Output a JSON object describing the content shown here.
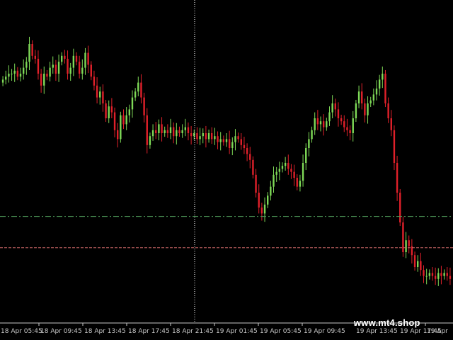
{
  "watermark": "www.mt4.shop",
  "chart_data": {
    "type": "candlestick",
    "up_color": "#7ed957",
    "down_color": "#e0202a",
    "background": "#000000",
    "grid": false,
    "x_tick_labels": [
      "18 Apr 05:45",
      "18 Apr 09:45",
      "18 Apr 13:45",
      "18 Apr 17:45",
      "18 Apr 21:45",
      "19 Apr 01:45",
      "19 Apr 05:45",
      "19 Apr 09:45",
      "19 Apr 13:45",
      "19 Apr 17:45",
      "19 Apr"
    ],
    "hlines": [
      {
        "style": "dash-dot",
        "color": "#4f9a5a",
        "level": 0.32
      },
      {
        "style": "dashed",
        "color": "#d46a6a",
        "level": 0.215
      }
    ],
    "crosshair_vline_index": 4.55,
    "closes": [
      0.78,
      0.79,
      0.8,
      0.8,
      0.81,
      0.79,
      0.8,
      0.82,
      0.84,
      0.9,
      0.86,
      0.85,
      0.8,
      0.76,
      0.8,
      0.79,
      0.82,
      0.83,
      0.8,
      0.84,
      0.86,
      0.85,
      0.8,
      0.82,
      0.86,
      0.84,
      0.8,
      0.82,
      0.87,
      0.83,
      0.79,
      0.76,
      0.72,
      0.74,
      0.7,
      0.65,
      0.69,
      0.67,
      0.61,
      0.58,
      0.66,
      0.63,
      0.66,
      0.68,
      0.72,
      0.74,
      0.77,
      0.72,
      0.66,
      0.56,
      0.59,
      0.61,
      0.6,
      0.63,
      0.6,
      0.61,
      0.6,
      0.62,
      0.59,
      0.61,
      0.6,
      0.61,
      0.62,
      0.6,
      0.59,
      0.6,
      0.58,
      0.59,
      0.6,
      0.58,
      0.6,
      0.58,
      0.59,
      0.57,
      0.58,
      0.57,
      0.58,
      0.55,
      0.57,
      0.59,
      0.58,
      0.56,
      0.55,
      0.53,
      0.51,
      0.46,
      0.4,
      0.35,
      0.33,
      0.36,
      0.39,
      0.42,
      0.46,
      0.47,
      0.48,
      0.49,
      0.5,
      0.48,
      0.47,
      0.45,
      0.42,
      0.44,
      0.5,
      0.55,
      0.58,
      0.61,
      0.65,
      0.63,
      0.64,
      0.62,
      0.64,
      0.67,
      0.7,
      0.68,
      0.65,
      0.64,
      0.62,
      0.61,
      0.6,
      0.65,
      0.7,
      0.74,
      0.7,
      0.66,
      0.7,
      0.71,
      0.73,
      0.75,
      0.78,
      0.8,
      0.7,
      0.65,
      0.61,
      0.5,
      0.4,
      0.3,
      0.2,
      0.24,
      0.22,
      0.19,
      0.15,
      0.17,
      0.14,
      0.12,
      0.12,
      0.13,
      0.12,
      0.11,
      0.13,
      0.12,
      0.13,
      0.12,
      0.11
    ]
  }
}
